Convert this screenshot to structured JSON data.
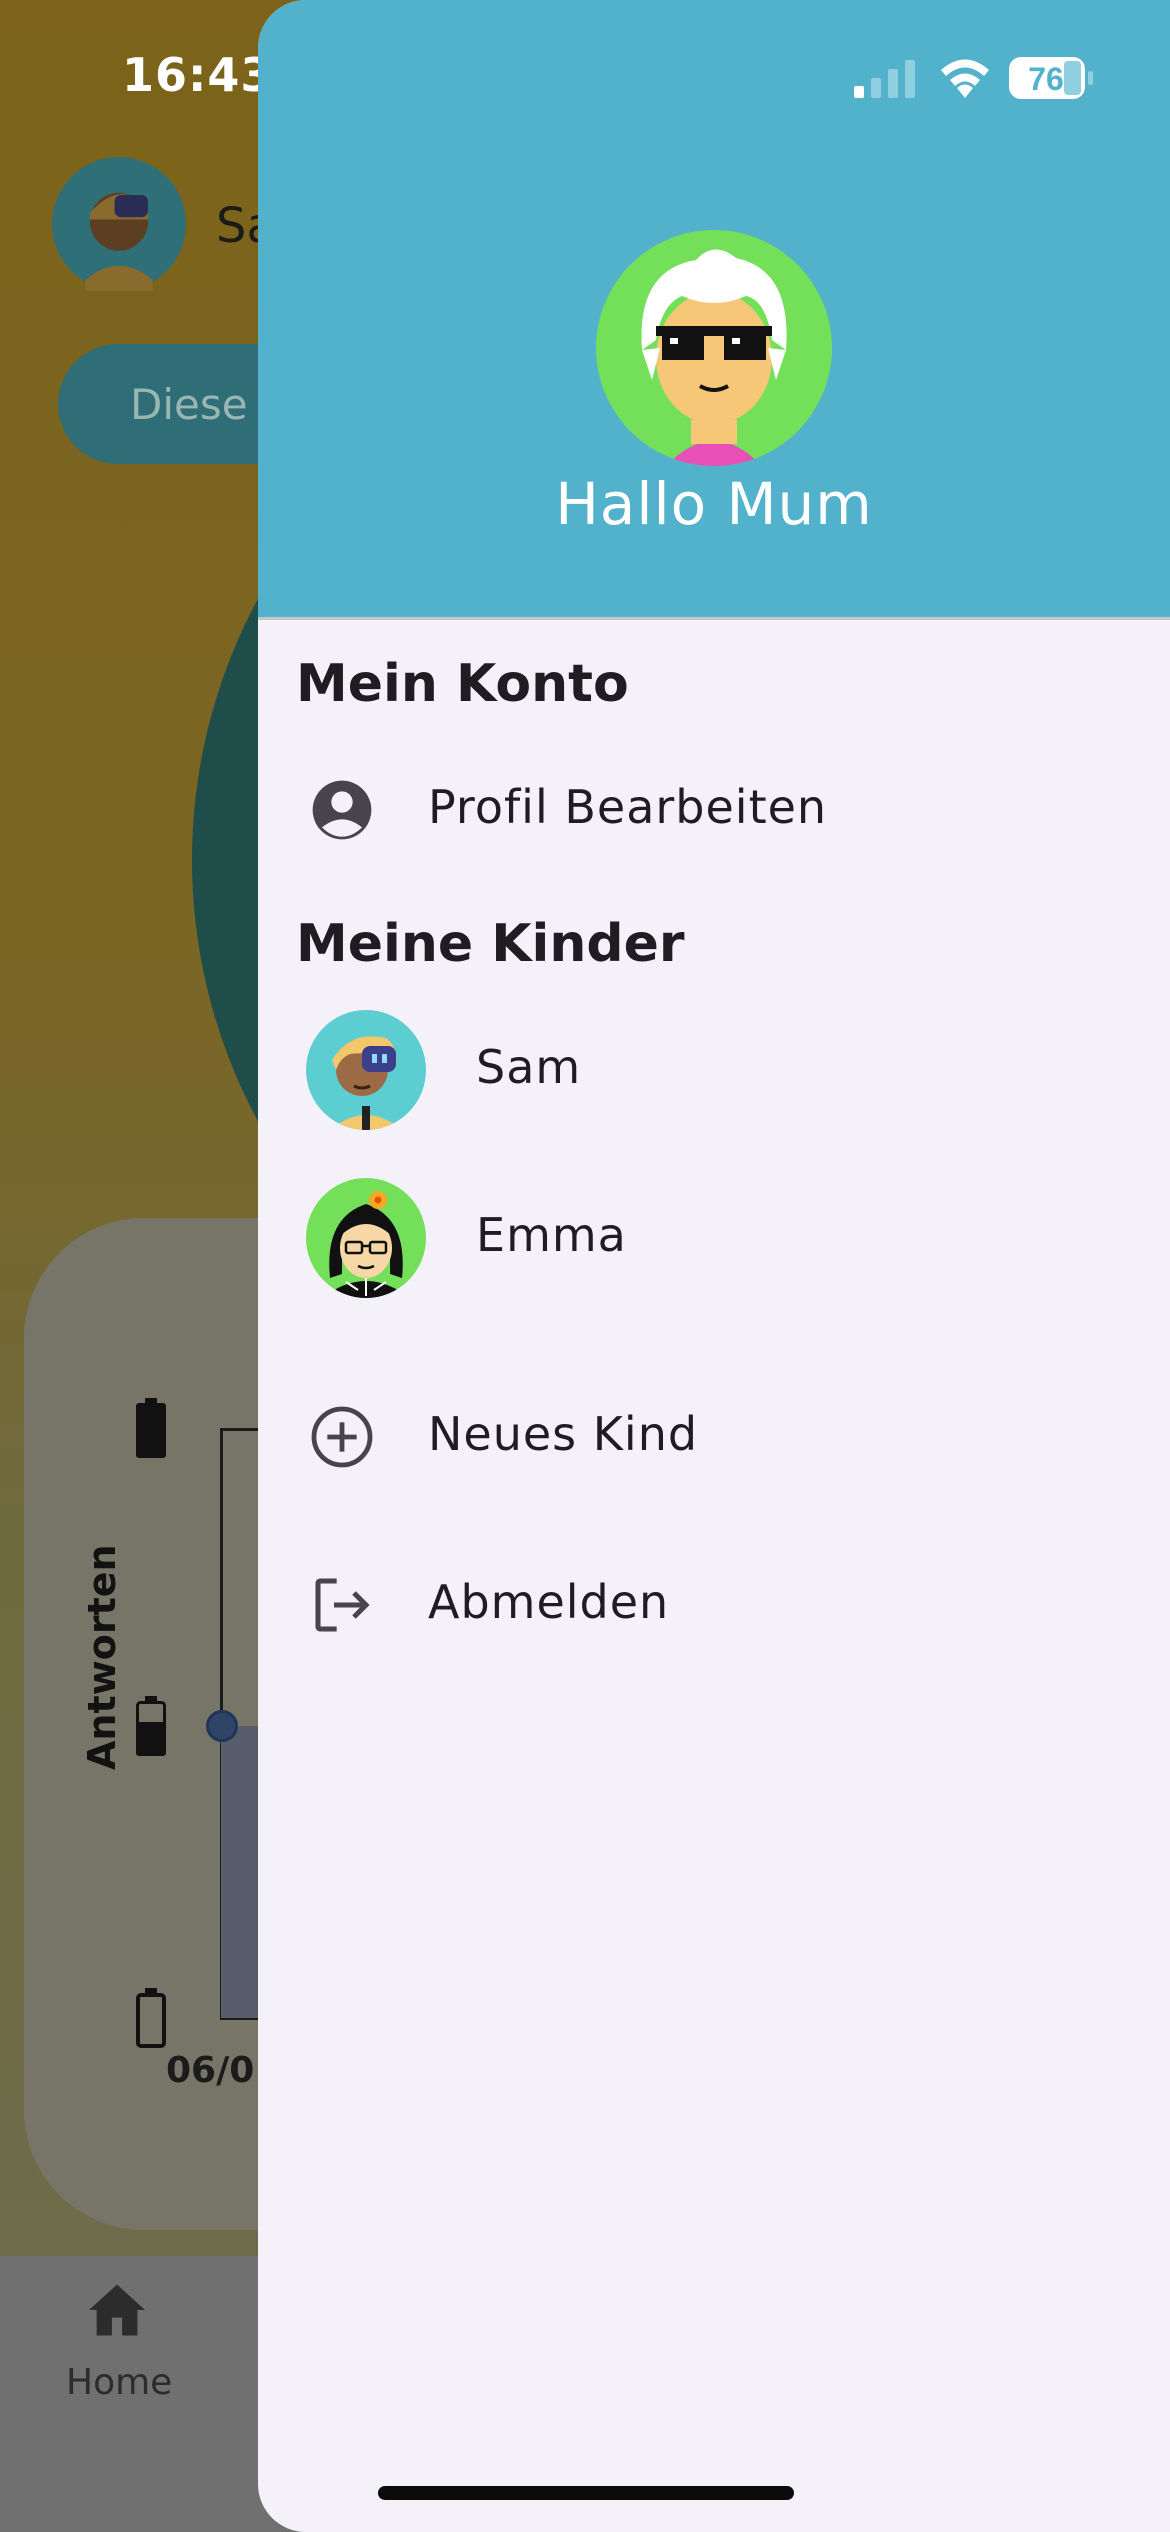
{
  "status_bar": {
    "time": "16:43",
    "battery": "76"
  },
  "background": {
    "child_name": "Sa",
    "pill_label": "Diese",
    "chart_ylabel": "Antworten",
    "chart_xtick": "06/0",
    "nav_home_label": "Home"
  },
  "drawer": {
    "header": {
      "greeting": "Hallo Mum"
    },
    "account_section": {
      "title": "Mein Konto",
      "items": [
        {
          "label": "Profil Bearbeiten",
          "icon": "account-circle-icon"
        }
      ]
    },
    "children_section": {
      "title": "Meine Kinder",
      "children": [
        {
          "name": "Sam",
          "icon": "sam-avatar"
        },
        {
          "name": "Emma",
          "icon": "emma-avatar"
        }
      ]
    },
    "actions": [
      {
        "label": "Neues Kind",
        "icon": "add-circle-icon"
      },
      {
        "label": "Abmelden",
        "icon": "logout-icon"
      }
    ]
  },
  "colors": {
    "drawer_header": "#52b1cb",
    "drawer_bg": "#f5f1f8",
    "avatar_green": "#74e05a",
    "avatar_teal": "#5ccdd0"
  }
}
